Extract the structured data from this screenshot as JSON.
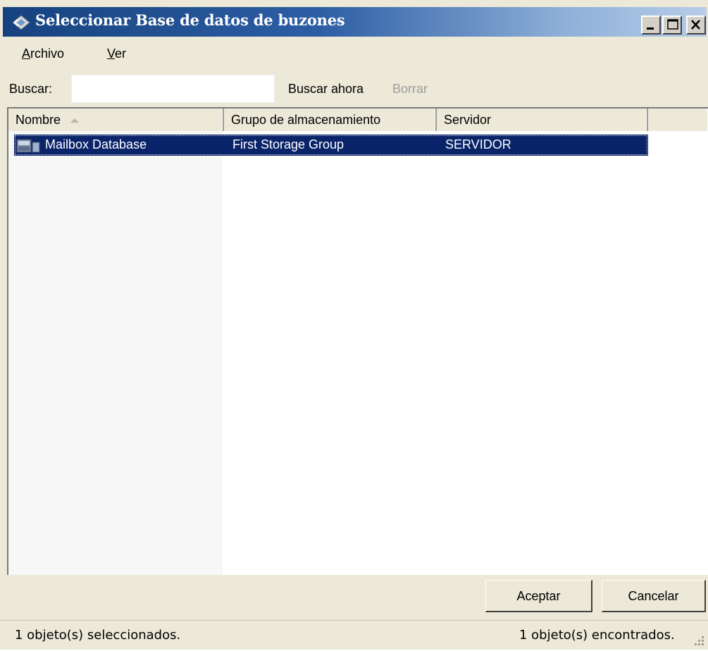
{
  "window": {
    "title": "Seleccionar Base de datos de buzones",
    "icon": "exchange-database-icon",
    "controls": [
      "minimize-icon",
      "maximize-icon",
      "close-icon"
    ]
  },
  "menu": {
    "archivo_first": "A",
    "archivo_rest": "rchivo",
    "ver_first": "V",
    "ver_rest": "er"
  },
  "search": {
    "label": "Buscar:",
    "value": "",
    "placeholder": "",
    "search_now": "Buscar ahora",
    "clear": "Borrar"
  },
  "list": {
    "columns": [
      "Nombre",
      "Grupo de almacenamiento",
      "Servidor"
    ],
    "sort_column": "Nombre",
    "rows": [
      {
        "icon": "mailbox-database-icon",
        "name": "Mailbox Database",
        "group": "First Storage Group",
        "server": "SERVIDOR",
        "selected": true
      }
    ]
  },
  "buttons": {
    "ok": "Aceptar",
    "cancel": "Cancelar"
  },
  "status": {
    "left": "1 objeto(s) seleccionados.",
    "right": "1 objeto(s) encontrados."
  },
  "colors": {
    "title_start": "#16427f",
    "title_end": "#b7cde8",
    "selection": "#0a246a",
    "face": "#ece9d8"
  }
}
